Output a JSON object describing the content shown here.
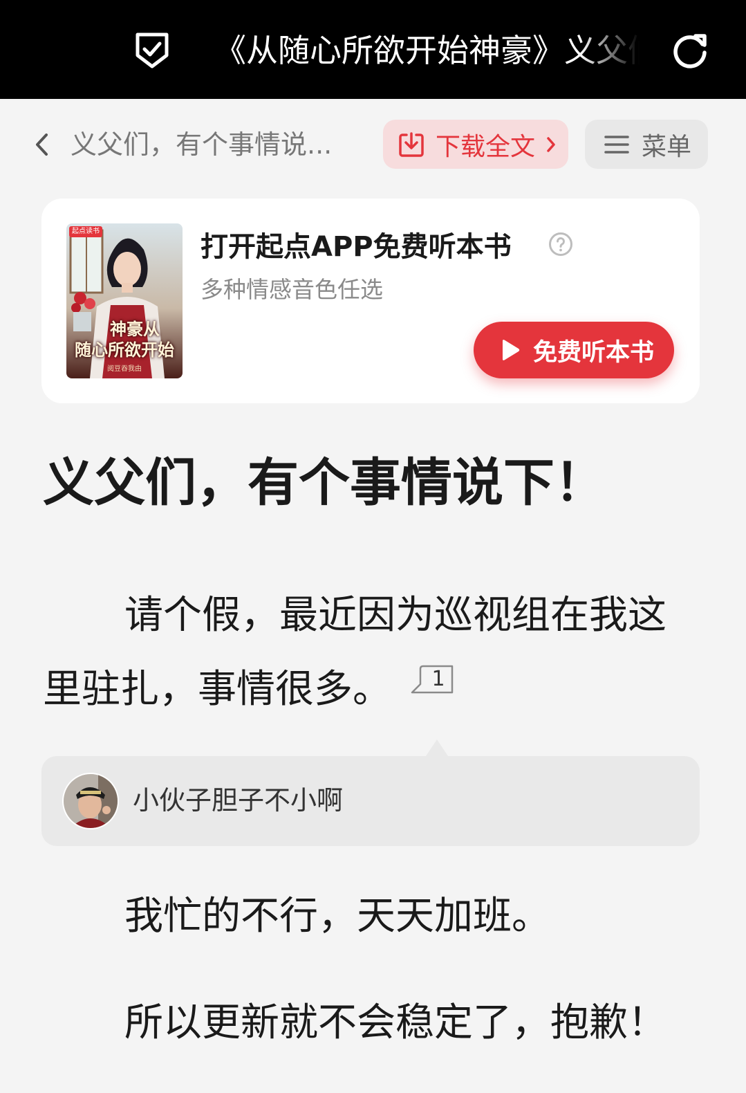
{
  "browser": {
    "title": "《从随心所欲开始神豪》义父们，有个事情说下！"
  },
  "header": {
    "chapter_title_short": "义父们，有个事情说...",
    "download_label": "下载全文",
    "menu_label": "菜单"
  },
  "promo": {
    "title": "打开起点APP免费听本书",
    "subtitle": "多种情感音色任选",
    "listen_label": "免费听本书",
    "cover": {
      "badge": "起点读书",
      "title_line1": "神豪从",
      "title_line2": "随心所欲开始",
      "author": "阅豆吞我由"
    }
  },
  "chapter": {
    "heading": "义父们，有个事情说下！",
    "para1_line1": "请个假，最近因为巡视组在我这",
    "para1_line2": "里驻扎，事情很多。",
    "para1_comment_count": "1",
    "para2": "我忙的不行，天天加班。",
    "para3": "所以更新就不会稳定了，抱歉！"
  },
  "comment": {
    "text": "小伙子胆子不小啊"
  },
  "colors": {
    "accent": "#e4353c",
    "accent_soft": "#f7dcdd",
    "topbar": "#000000",
    "page_bg": "#f4f4f4"
  },
  "icons": {
    "shield": "shield-check-icon",
    "reload": "reload-icon",
    "back": "chevron-left-icon",
    "download": "download-icon",
    "menu": "hamburger-menu-icon",
    "help": "question-circle-icon",
    "play": "play-icon",
    "comment": "comment-count-icon"
  }
}
